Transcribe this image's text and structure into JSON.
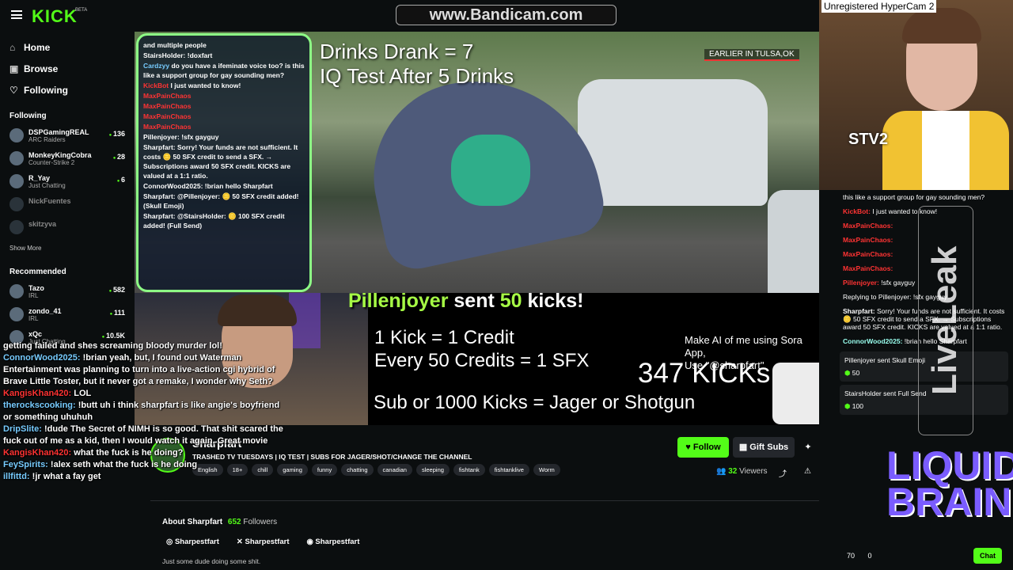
{
  "header": {
    "logo": "KICK",
    "beta": "BETA",
    "watermark": "www.Bandicam.com"
  },
  "nav": [
    {
      "label": "Home",
      "icon": "home-icon",
      "glyph": "⌂"
    },
    {
      "label": "Browse",
      "icon": "browse-icon",
      "glyph": "▣"
    },
    {
      "label": "Following",
      "icon": "heart-icon",
      "glyph": "♡"
    }
  ],
  "following": {
    "heading": "Following",
    "items": [
      {
        "name": "DSPGamingREAL",
        "sub": "ARC Raiders",
        "count": "136"
      },
      {
        "name": "MonkeyKingCobra",
        "sub": "Counter-Strike 2",
        "count": "28"
      },
      {
        "name": "R_Yay",
        "sub": "Just Chatting",
        "count": "6"
      },
      {
        "name": "NickFuentes",
        "sub": "",
        "count": ""
      },
      {
        "name": "skitzyva",
        "sub": "",
        "count": ""
      }
    ],
    "show_more": "Show More"
  },
  "recommended": {
    "heading": "Recommended",
    "items": [
      {
        "name": "Tazo",
        "sub": "IRL",
        "count": "582"
      },
      {
        "name": "zondo_41",
        "sub": "IRL",
        "count": "111"
      },
      {
        "name": "xQc",
        "sub": "Just Chatting",
        "count": "10.5K"
      }
    ]
  },
  "overlay_chat": [
    {
      "user": "",
      "text": "and multiple people"
    },
    {
      "user": "StairsHolder:",
      "text": "!doxfart",
      "uc": "cl"
    },
    {
      "user": "Cardzyy",
      "text": "do you have a ifeminate voice too? is this like a support group for gay sounding men?",
      "uc": "u"
    },
    {
      "user": "KickBot",
      "text": "I just wanted to know!",
      "uc": "red"
    },
    {
      "user": "MaxPainChaos",
      "text": "",
      "uc": "red"
    },
    {
      "user": "MaxPainChaos",
      "text": "",
      "uc": "red"
    },
    {
      "user": "MaxPainChaos",
      "text": "",
      "uc": "red"
    },
    {
      "user": "MaxPainChaos",
      "text": "",
      "uc": "red"
    },
    {
      "user": "Pillenjoyer:",
      "text": "!sfx gayguy",
      "uc": "cl"
    },
    {
      "user": "Sharpfart:",
      "text": "Sorry! Your funds are not sufficient. It costs 🪙 50 SFX credit to send a SFX. → Subscriptions award 50 SFX credit. KICKS are valued at a 1:1 ratio.",
      "uc": "cl"
    },
    {
      "user": "ConnorWood2025:",
      "text": "!brian hello Sharpfart",
      "uc": "cl"
    },
    {
      "user": "Sharpfart:",
      "text": "@Pillenjoyer: 🪙 50 SFX credit added! (Skull Emoji)",
      "uc": "cl"
    },
    {
      "user": "Sharpfart:",
      "text": "@StairsHolder: 🪙 100 SFX credit added! (Full Send)",
      "uc": "cl"
    }
  ],
  "video": {
    "drinks": "Drinks Drank = 7",
    "iq": "IQ Test After 5 Drinks",
    "earlier": "EARLIER IN TULSA,OK",
    "alert_name": "Pillenjoyer",
    "alert_mid": "sent",
    "alert_num": "50",
    "alert_end": "kicks!",
    "credit1": "1 Kick = 1 Credit",
    "credit2": "Every 50 Credits  = 1 SFX",
    "sub": "Sub or 1000 Kicks =  Jager or Shotgun",
    "ai1": "Make AI of me using Sora App,",
    "ai2": "Use \"@sharpfart\"",
    "kicks": "347 KICKs"
  },
  "rightcam": {
    "watermark": "Unregistered HyperCam 2",
    "tag": "STV2"
  },
  "right_chat": [
    {
      "user": "",
      "text": "this like a support group for gay sounding men?",
      "c": ""
    },
    {
      "user": "KickBot:",
      "text": "I just wanted to know!",
      "c": "red"
    },
    {
      "user": "MaxPainChaos:",
      "text": "",
      "c": "red"
    },
    {
      "user": "MaxPainChaos:",
      "text": "",
      "c": "red"
    },
    {
      "user": "MaxPainChaos:",
      "text": "",
      "c": "red"
    },
    {
      "user": "MaxPainChaos:",
      "text": "",
      "c": "red"
    },
    {
      "user": "Pillenjoyer:",
      "text": "!sfx gayguy",
      "c": "red"
    },
    {
      "user": "",
      "text": "Replying to Pillenjoyer: !sfx gayguy",
      "c": ""
    },
    {
      "user": "Sharpfart:",
      "text": "Sorry! Your funds are not sufficient. It costs 🪙 50 SFX credit to send a SFX. → Subscriptions award 50 SFX credit. KICKS are valued at a 1:1 ratio.",
      "c": ""
    },
    {
      "user": "ConnorWood2025:",
      "text": "!brian hello Sharpfart",
      "c": "g"
    }
  ],
  "gifts": [
    {
      "user": "Pillenjoyer",
      "text": "sent Skull Emoji",
      "amount": "50"
    },
    {
      "user": "StairsHolder",
      "text": "sent Full Send",
      "amount": "100"
    }
  ],
  "right_side_text": "LiveLeak",
  "liquid": "LIQUID BRAIN",
  "right_footer": {
    "coins": "70",
    "zero": "0",
    "chat_btn": "Chat"
  },
  "streamer": {
    "name": "Sharpfart",
    "title": "TRASHED TV TUESDAYS | IQ TEST | SUBS FOR JAGER/SHOT/CHANGE THE CHANNEL",
    "tags": [
      "English",
      "18+",
      "chill",
      "gaming",
      "funny",
      "chatting",
      "canadian",
      "sleeping",
      "fishtank",
      "fishtanklive",
      "Worm"
    ],
    "follow": "Follow",
    "gift": "Gift Subs",
    "viewers": "32",
    "viewers_label": "Viewers",
    "about": "About Sharpfart",
    "followers": "652",
    "followers_label": "Followers",
    "socials": [
      "Sharpestfart",
      "Sharpestfart",
      "Sharpestfart"
    ],
    "bio": "Just some dude doing some shit."
  },
  "floating_chat": [
    {
      "user": "",
      "text": "getting failed and shes screaming bloody murder lol!",
      "c": ""
    },
    {
      "user": "ConnorWood2025:",
      "text": "!brian yeah, but, I found out Waterman Entertainment was planning to turn into a live-action cgi hybrid of Brave Little Toster, but it never got a remake, I wonder why Seth?",
      "c": "u"
    },
    {
      "user": "KangisKhan420:",
      "text": "LOL",
      "c": "r"
    },
    {
      "user": "therockscooking:",
      "text": "!butt uh i think sharpfart is like angie's boyfriend or something uhuhuh",
      "c": "u"
    },
    {
      "user": "DripSlite:",
      "text": "!dude The Secret of NIMH is so good. That shit scared the fuck out of me as a kid, then I would watch it again. Great movie",
      "c": "u"
    },
    {
      "user": "KangisKhan420:",
      "text": "what the fuck is he doing?",
      "c": "r"
    },
    {
      "user": "FeySpirits:",
      "text": "!alex seth what the fuck is he doing",
      "c": "u"
    },
    {
      "user": "illfittd:",
      "text": "!jr what a fay get",
      "c": "u"
    }
  ]
}
